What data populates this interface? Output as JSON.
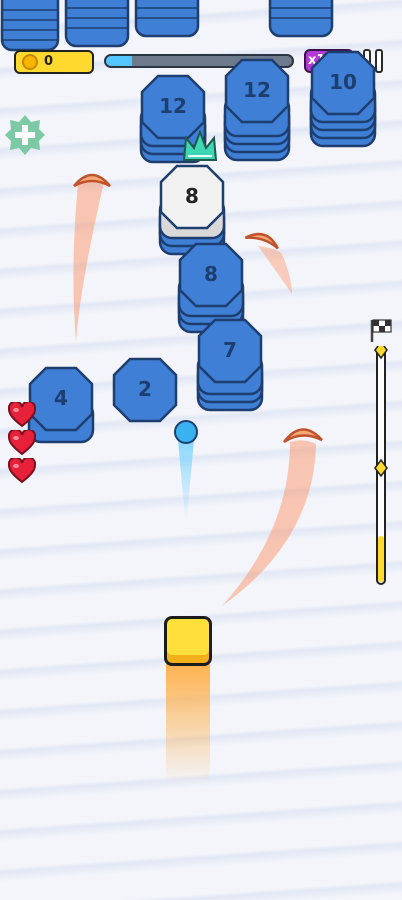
{
  "hud": {
    "coins": "0",
    "level_progress": 0.14,
    "speed_label": "x1",
    "speed_icon": "fast-forward-icon",
    "pause_icon": "pause-icon",
    "boost_icon": "plus-icon"
  },
  "colors": {
    "block_blue": "#3f7fd6",
    "block_dark": "#1d3e6e",
    "block_white": "#f2f2f2",
    "paddle_yellow": "#ffe03a",
    "coin_bar": "#ffd92e",
    "speed_purple": "#b43ad6",
    "heart_red": "#e8213a",
    "crown_teal": "#3fd6b4"
  },
  "blocks": [
    {
      "value": "12"
    },
    {
      "value": "12"
    },
    {
      "value": "10"
    },
    {
      "value": "8"
    },
    {
      "value": "8"
    },
    {
      "value": "7"
    },
    {
      "value": "4"
    },
    {
      "value": "2"
    }
  ],
  "lives": 3,
  "level_marker": {
    "icon": "checkered-flag-icon",
    "fill": 0.2
  }
}
